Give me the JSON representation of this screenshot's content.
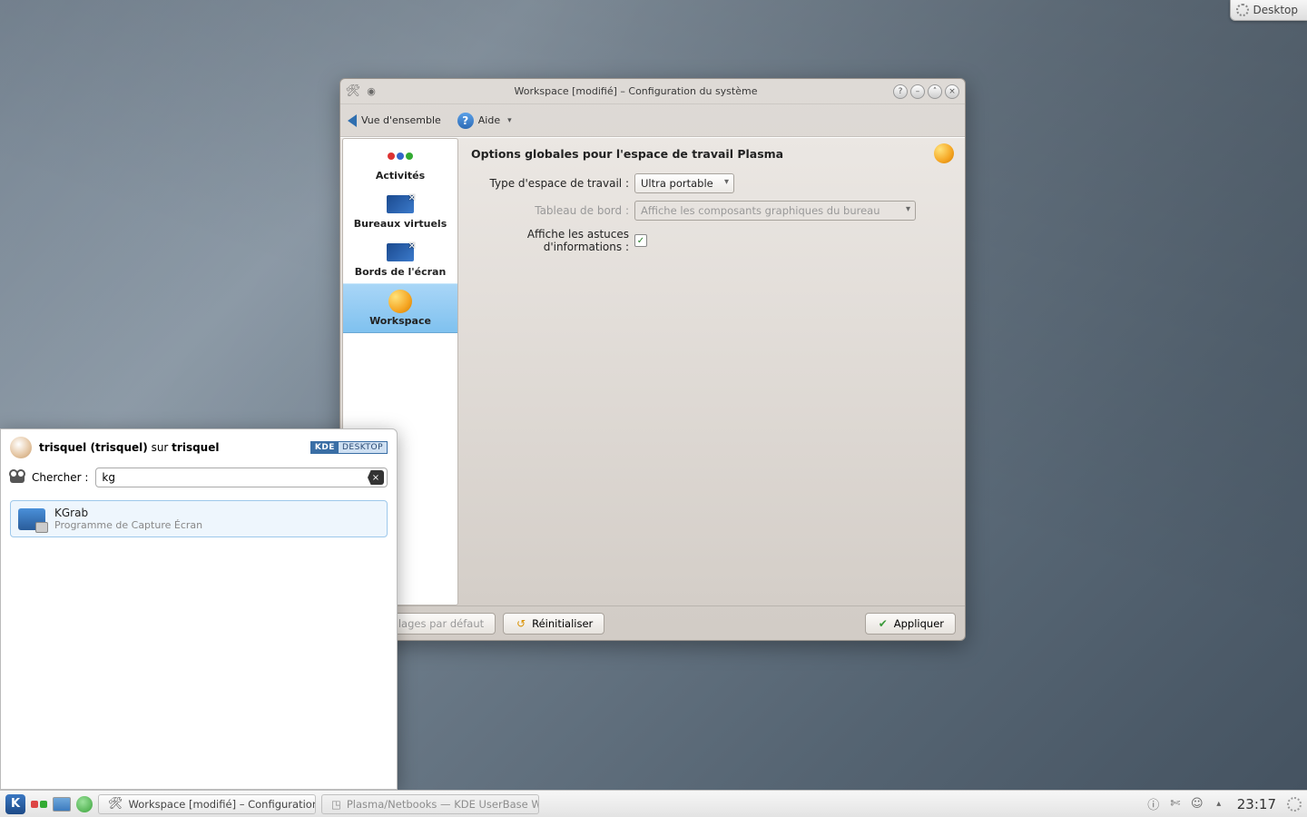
{
  "cashew": {
    "label": "Desktop"
  },
  "window": {
    "title": "Workspace [modifié] – Configuration du système",
    "toolbar": {
      "overview": "Vue d'ensemble",
      "help": "Aide"
    },
    "sidebar": [
      {
        "label": "Activités"
      },
      {
        "label": "Bureaux virtuels"
      },
      {
        "label": "Bords de l'écran"
      },
      {
        "label": "Workspace"
      }
    ],
    "content": {
      "heading": "Options globales pour l'espace de travail Plasma",
      "workspace_type_label": "Type d'espace de travail :",
      "workspace_type_value": "Ultra portable",
      "dashboard_label": "Tableau de bord :",
      "dashboard_value": "Affiche les composants graphiques du bureau",
      "tooltip_label": "Affiche les astuces d'informations :",
      "tooltip_checked": true
    },
    "footer": {
      "defaults": "Réglages par défaut",
      "reset": "Réinitialiser",
      "apply": "Appliquer"
    }
  },
  "kickoff": {
    "user_prefix": "trisquel (trisquel)",
    "user_mid": " sur ",
    "user_host": "trisquel",
    "branding_left": "KDE",
    "branding_right": "DESKTOP",
    "search_label": "Chercher :",
    "search_value": "kg",
    "result": {
      "name": "KGrab",
      "desc": "Programme de Capture Écran"
    }
  },
  "panel": {
    "task1": "Workspace [modifié] – Configuration du …",
    "task2": "Plasma/Netbooks — KDE UserBase Wiki",
    "clock": "23:17"
  }
}
